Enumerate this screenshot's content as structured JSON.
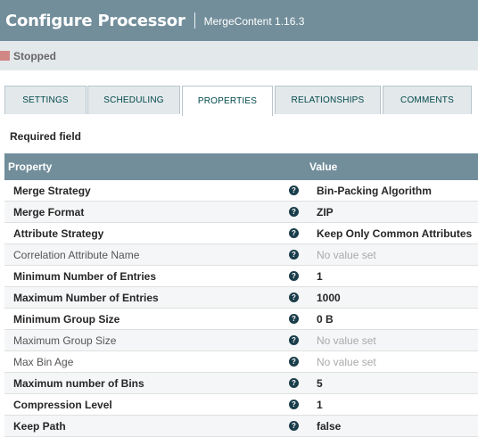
{
  "header": {
    "title": "Configure Processor",
    "subtitle": "MergeContent 1.16.3"
  },
  "status": {
    "label": "Stopped",
    "color": "#d18686"
  },
  "tabs": [
    {
      "label": "SETTINGS",
      "active": false
    },
    {
      "label": "SCHEDULING",
      "active": false
    },
    {
      "label": "PROPERTIES",
      "active": true
    },
    {
      "label": "RELATIONSHIPS",
      "active": false
    },
    {
      "label": "COMMENTS",
      "active": false
    }
  ],
  "required_field_label": "Required field",
  "table": {
    "columns": {
      "property": "Property",
      "value": "Value"
    },
    "rows": [
      {
        "property": "Merge Strategy",
        "value": "Bin-Packing Algorithm",
        "required": true,
        "empty": false
      },
      {
        "property": "Merge Format",
        "value": "ZIP",
        "required": true,
        "empty": false
      },
      {
        "property": "Attribute Strategy",
        "value": "Keep Only Common Attributes",
        "required": true,
        "empty": false
      },
      {
        "property": "Correlation Attribute Name",
        "value": "No value set",
        "required": false,
        "empty": true
      },
      {
        "property": "Minimum Number of Entries",
        "value": "1",
        "required": true,
        "empty": false
      },
      {
        "property": "Maximum Number of Entries",
        "value": "1000",
        "required": true,
        "empty": false
      },
      {
        "property": "Minimum Group Size",
        "value": "0 B",
        "required": true,
        "empty": false
      },
      {
        "property": "Maximum Group Size",
        "value": "No value set",
        "required": false,
        "empty": true
      },
      {
        "property": "Max Bin Age",
        "value": "No value set",
        "required": false,
        "empty": true
      },
      {
        "property": "Maximum number of Bins",
        "value": "5",
        "required": true,
        "empty": false
      },
      {
        "property": "Compression Level",
        "value": "1",
        "required": true,
        "empty": false
      },
      {
        "property": "Keep Path",
        "value": "false",
        "required": true,
        "empty": false
      }
    ]
  },
  "icons": {
    "help": "help-icon",
    "help_glyph": "?"
  },
  "colors": {
    "header_bg": "#728e9b",
    "status_bg": "#e3e8eb",
    "tab_text": "#004849"
  }
}
